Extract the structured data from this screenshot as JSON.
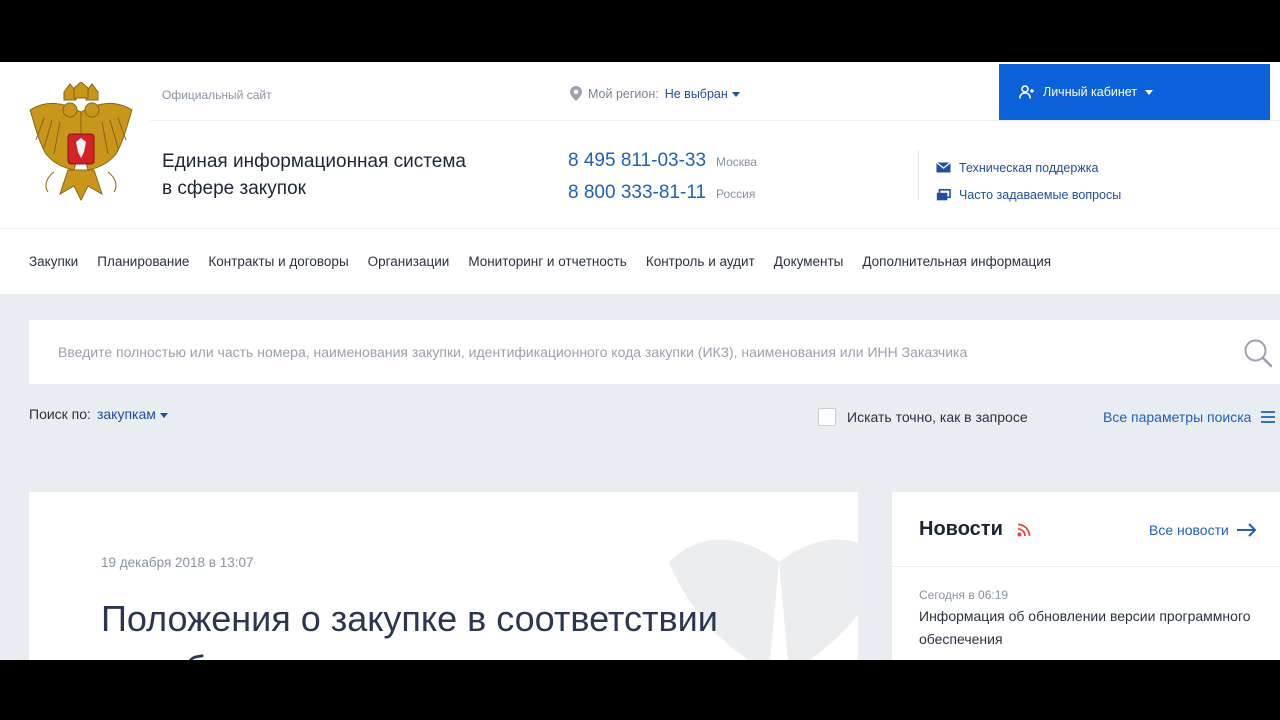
{
  "header": {
    "official_label": "Официальный сайт",
    "region_label": "Мой регион:",
    "region_value": "Не выбран",
    "cabinet_label": "Личный кабинет",
    "title_line1": "Единая информационная система",
    "title_line2": "в сфере закупок",
    "phones": [
      {
        "number": "8 495 811-03-33",
        "city": "Москва"
      },
      {
        "number": "8 800 333-81-11",
        "city": "Россия"
      }
    ],
    "support_label": "Техническая поддержка",
    "faq_label": "Часто задаваемые вопросы"
  },
  "nav": {
    "items": [
      "Закупки",
      "Планирование",
      "Контракты и договоры",
      "Организации",
      "Мониторинг и отчетность",
      "Контроль и аудит",
      "Документы",
      "Дополнительная информация"
    ]
  },
  "search": {
    "placeholder": "Введите полностью или часть номера, наименования закупки, идентификационного кода закупки (ИКЗ), наименования или ИНН Заказчика",
    "by_label": "Поиск по:",
    "by_value": "закупкам",
    "exact_label": "Искать точно, как в запросе",
    "all_params_label": "Все параметры поиска"
  },
  "article": {
    "date": "19 декабря 2018 в 13:07",
    "title": "Положения о закупке в соответствии с требованиями"
  },
  "news": {
    "heading": "Новости",
    "all_label": "Все новости",
    "items": [
      {
        "time": "Сегодня в 06:19",
        "text": "Информация об обновлении версии программного обеспечения"
      }
    ]
  },
  "colors": {
    "brand_blue": "#0b61d9",
    "link_blue": "#1f5fbf",
    "rss_orange": "#e8492f"
  },
  "icons": [
    "emblem-icon",
    "location-pin-icon",
    "user-icon",
    "mail-icon",
    "faq-icon",
    "search-icon",
    "rss-icon",
    "arrow-right-icon",
    "list-icon"
  ]
}
